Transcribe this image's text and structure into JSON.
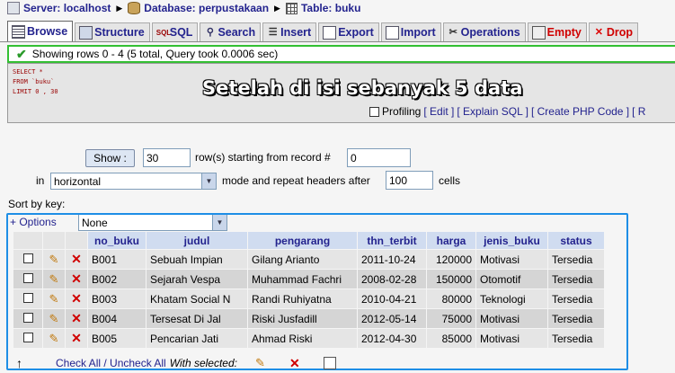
{
  "breadcrumb": {
    "server": "Server: localhost",
    "database": "Database: perpustakaan",
    "table": "Table: buku",
    "sep": "▶"
  },
  "tabs": [
    {
      "label": "Browse",
      "icon": "browse-icon",
      "active": true
    },
    {
      "label": "Structure",
      "icon": "structure-icon"
    },
    {
      "label": "SQL",
      "icon": "sql-icon"
    },
    {
      "label": "Search",
      "icon": "search-icon"
    },
    {
      "label": "Insert",
      "icon": "insert-icon"
    },
    {
      "label": "Export",
      "icon": "export-icon"
    },
    {
      "label": "Import",
      "icon": "import-icon"
    },
    {
      "label": "Operations",
      "icon": "operations-icon"
    },
    {
      "label": "Empty",
      "icon": "empty-icon",
      "danger": true
    },
    {
      "label": "Drop",
      "icon": "drop-icon",
      "danger": true
    }
  ],
  "notice": "Showing rows 0 - 4 (5 total, Query took 0.0006 sec)",
  "sql_lines": [
    "SELECT *",
    "FROM `buku`",
    "LIMIT 0 , 30"
  ],
  "overlay_text": "Setelah di isi sebanyak 5 data",
  "profiling": {
    "label": "Profiling",
    "links": [
      "[ Edit ]",
      "[ Explain SQL ]",
      "[ Create PHP Code ]",
      "[ R"
    ]
  },
  "nav": {
    "show_button": "Show :",
    "rows_value": "30",
    "rows_label": "row(s) starting from record #",
    "start_value": "0",
    "in_label": "in",
    "mode_value": "horizontal",
    "mode_label": "mode and repeat headers after",
    "headers_value": "100",
    "cells_label": "cells"
  },
  "sort": {
    "label": "Sort by key:",
    "value": "None"
  },
  "options_link": "+ Options",
  "table": {
    "columns": [
      "no_buku",
      "judul",
      "pengarang",
      "thn_terbit",
      "harga",
      "jenis_buku",
      "status"
    ],
    "rows": [
      [
        "B001",
        "Sebuah Impian",
        "Gilang Arianto",
        "2011-10-24",
        "120000",
        "Motivasi",
        "Tersedia"
      ],
      [
        "B002",
        "Sejarah Vespa",
        "Muhammad Fachri",
        "2008-02-28",
        "150000",
        "Otomotif",
        "Tersedia"
      ],
      [
        "B003",
        "Khatam Social N",
        "Randi Ruhiyatna",
        "2010-04-21",
        "80000",
        "Teknologi",
        "Tersedia"
      ],
      [
        "B004",
        "Tersesat Di Jal",
        "Riski Jusfadill",
        "2012-05-14",
        "75000",
        "Motivasi",
        "Tersedia"
      ],
      [
        "B005",
        "Pencarian Jati",
        "Ahmad Riski",
        "2012-04-30",
        "85000",
        "Motivasi",
        "Tersedia"
      ]
    ]
  },
  "footer": {
    "check_all": "Check All / Uncheck All",
    "with_selected": "With selected:"
  },
  "colors": {
    "notice_border": "#33c033",
    "highlight_border": "#1e8ee6",
    "link": "#23238e",
    "danger": "#d00000"
  }
}
